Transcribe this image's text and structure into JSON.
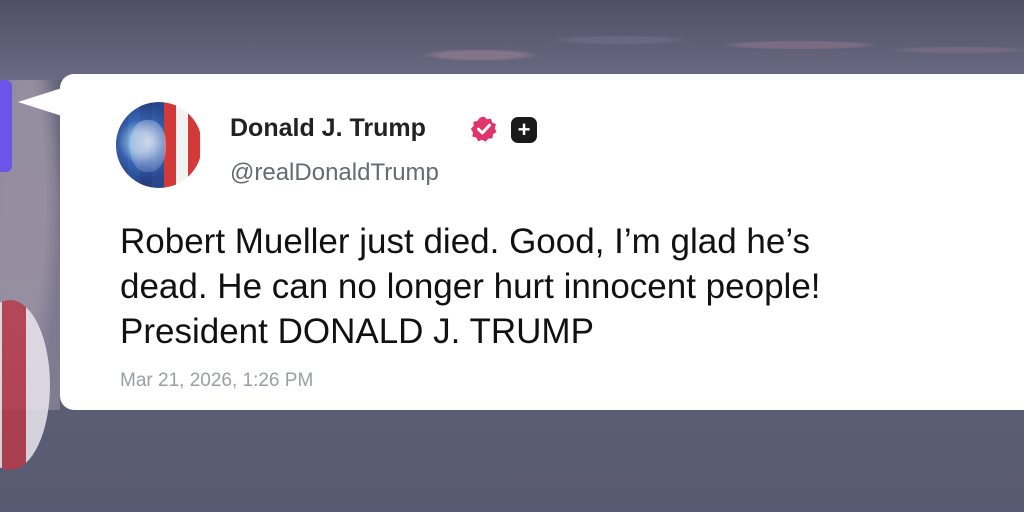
{
  "post": {
    "display_name": "Donald J. Trump",
    "handle": "@realDonaldTrump",
    "verified_icon": "verified-badge-icon",
    "plus_icon": "plus-badge-icon",
    "plus_glyph": "+",
    "text_lines": [
      "Robert Mueller just died. Good, I’m glad he’s",
      "dead. He can no longer hurt innocent people!",
      "President DONALD J. TRUMP"
    ],
    "timestamp": "Mar 21, 2026, 1:26 PM"
  },
  "colors": {
    "verified": "#e0356b",
    "card": "#ffffff",
    "accent_tab": "#6a55e8"
  }
}
